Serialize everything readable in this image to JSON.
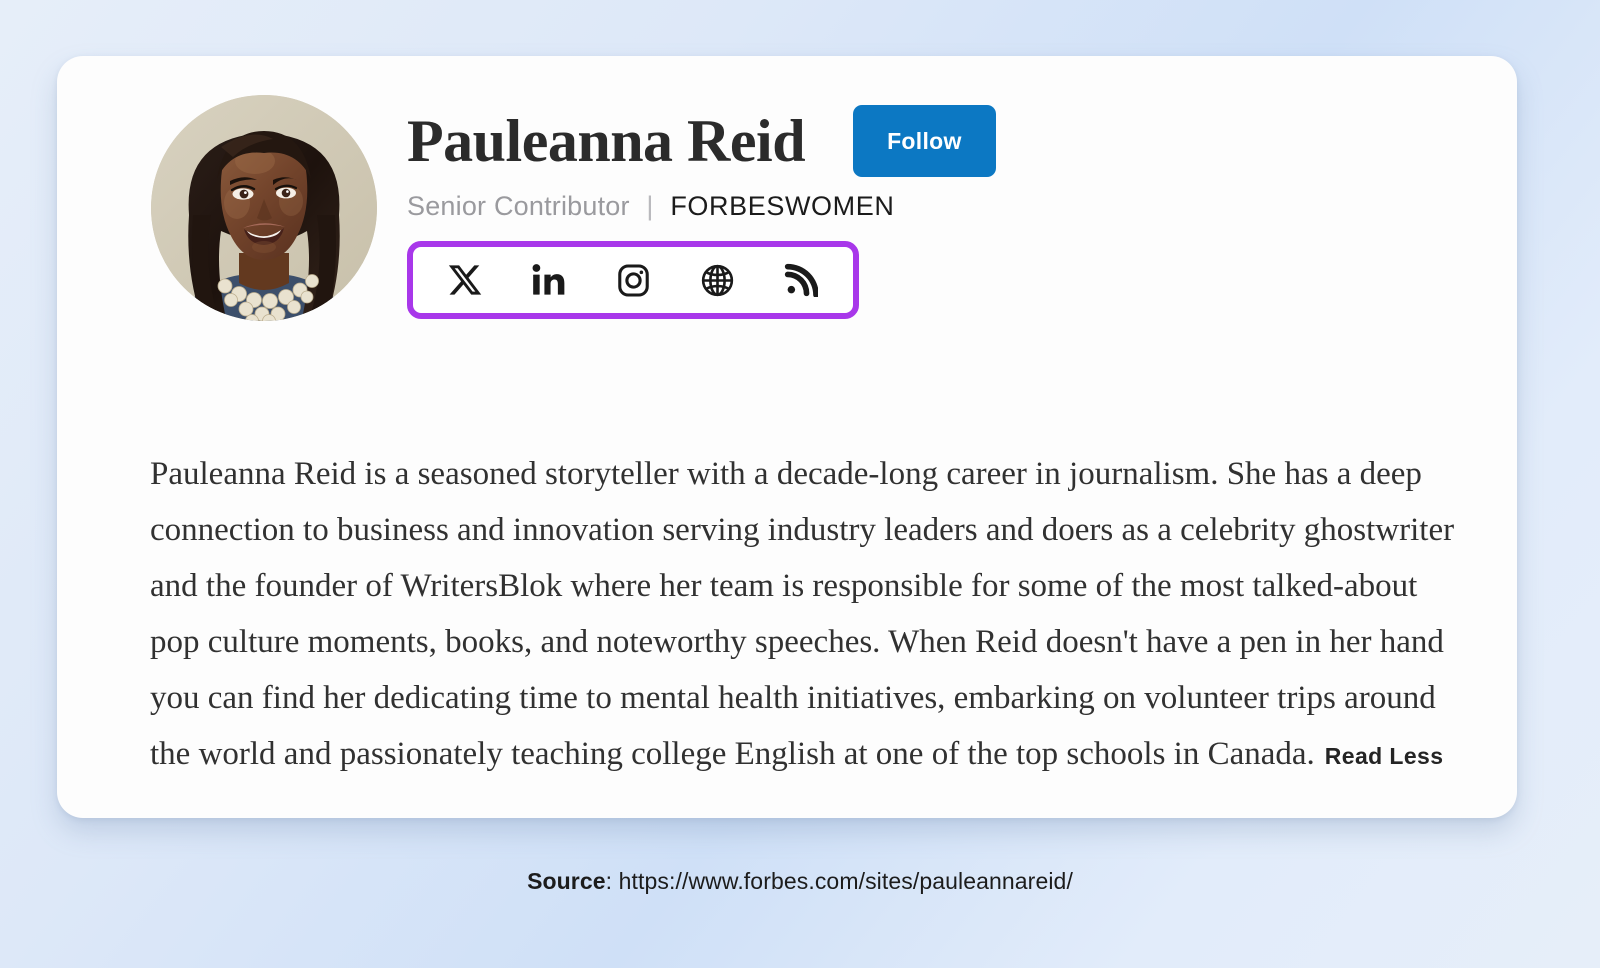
{
  "theme": {
    "page_background_from": "#e6eef9",
    "page_background_to": "#cfe0f7",
    "card_background": "#fdfdfd",
    "highlight_color": "#a837ea",
    "accent_button_color": "#0c78c3",
    "name_color": "#2b2b2b",
    "role_color": "#9a9a9e",
    "section_color": "#1b1b1b",
    "bio_color": "#313131"
  },
  "profile": {
    "name": "Pauleanna Reid",
    "role": "Senior Contributor",
    "separator": "|",
    "section": "FORBESWOMEN",
    "avatar_alt": "Pauleanna Reid headshot",
    "follow_label": "Follow"
  },
  "social_links": [
    {
      "name": "x-twitter-icon",
      "label": "X"
    },
    {
      "name": "linkedin-icon",
      "label": "LinkedIn"
    },
    {
      "name": "instagram-icon",
      "label": "Instagram"
    },
    {
      "name": "globe-icon",
      "label": "Website"
    },
    {
      "name": "rss-icon",
      "label": "RSS Feed"
    }
  ],
  "bio": {
    "text": "Pauleanna Reid is a seasoned storyteller with a decade-long career in journalism. She has a deep connection to business and innovation serving industry leaders and doers as a celebrity ghostwriter and the founder of WritersBlok where her team is responsible for some of the most talked-about pop culture moments, books, and noteworthy speeches. When Reid doesn't have a pen in her hand you can find her dedicating time to mental health initiatives, embarking on volunteer trips around the world and passionately teaching college English at one of the top schools in Canada.",
    "toggle_label": "Read Less"
  },
  "source": {
    "label": "Source",
    "separator": ": ",
    "url": "https://www.forbes.com/sites/pauleannareid/"
  }
}
